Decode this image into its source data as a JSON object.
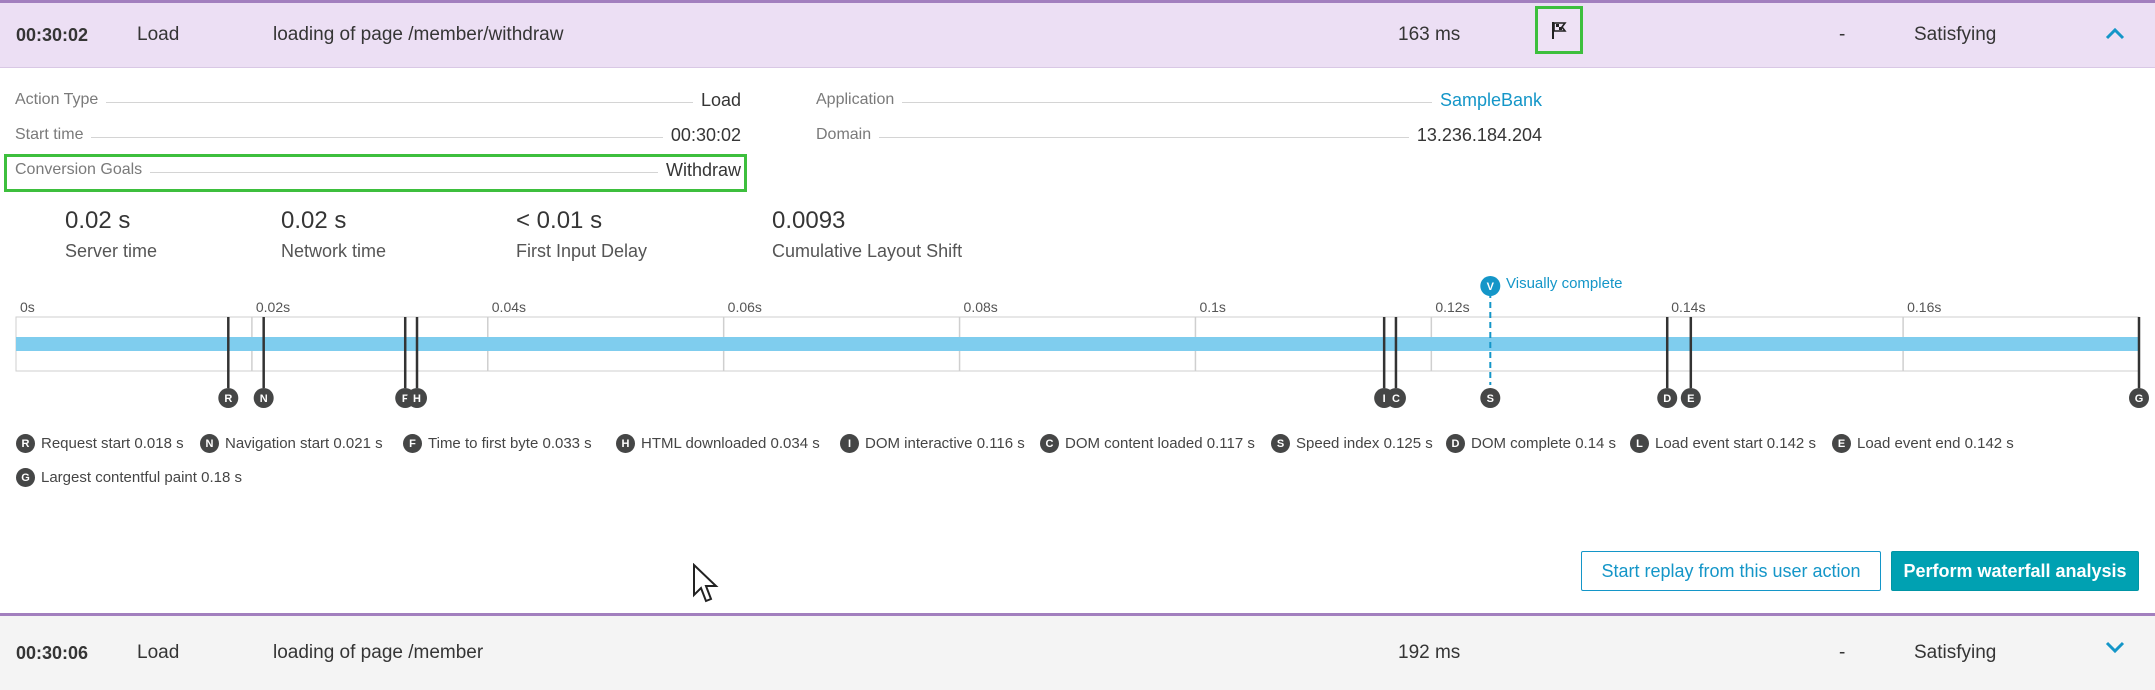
{
  "action_row": {
    "time": "00:30:02",
    "type": "Load",
    "name": "loading of page /member/withdraw",
    "duration": "163 ms",
    "dash": "-",
    "apdex": "Satisfying",
    "flag_icon": "conversion-goal-flag-icon"
  },
  "details": {
    "action_type_label": "Action Type",
    "action_type_value": "Load",
    "start_time_label": "Start time",
    "start_time_value": "00:30:02",
    "conversion_goals_label": "Conversion Goals",
    "conversion_goals_value": "Withdraw",
    "application_label": "Application",
    "application_value": "SampleBank",
    "domain_label": "Domain",
    "domain_value": "13.236.184.204"
  },
  "metrics": [
    {
      "value": "0.02 s",
      "label": "Server time"
    },
    {
      "value": "0.02 s",
      "label": "Network time"
    },
    {
      "value": "< 0.01 s",
      "label": "First Input Delay"
    },
    {
      "value": "0.0093",
      "label": "Cumulative Layout Shift"
    }
  ],
  "timeline": {
    "axis_labels": [
      "0s",
      "0.02s",
      "0.04s",
      "0.06s",
      "0.08s",
      "0.1s",
      "0.12s",
      "0.14s",
      "0.16s"
    ],
    "axis_values": [
      0,
      0.02,
      0.04,
      0.06,
      0.08,
      0.1,
      0.12,
      0.14,
      0.16
    ],
    "max": 0.18,
    "bar_color": "#7fcdee",
    "visually_complete_label": "Visually complete",
    "visually_complete_badge": "V",
    "visually_complete_time": 0.125,
    "markers": [
      {
        "letter": "R",
        "time": 0.018
      },
      {
        "letter": "N",
        "time": 0.021
      },
      {
        "letter": "F",
        "time": 0.033
      },
      {
        "letter": "H",
        "time": 0.034
      },
      {
        "letter": "I",
        "time": 0.116
      },
      {
        "letter": "C",
        "time": 0.117
      },
      {
        "letter": "S",
        "time": 0.125
      },
      {
        "letter": "D",
        "time": 0.14
      },
      {
        "letter": "E",
        "time": 0.142
      },
      {
        "letter": "G",
        "time": 0.18
      }
    ]
  },
  "legend": [
    {
      "letter": "R",
      "text": "Request start 0.018 s"
    },
    {
      "letter": "N",
      "text": "Navigation start 0.021 s"
    },
    {
      "letter": "F",
      "text": "Time to first byte 0.033 s"
    },
    {
      "letter": "H",
      "text": "HTML downloaded 0.034 s"
    },
    {
      "letter": "I",
      "text": "DOM interactive 0.116 s"
    },
    {
      "letter": "C",
      "text": "DOM content loaded 0.117 s"
    },
    {
      "letter": "S",
      "text": "Speed index 0.125 s"
    },
    {
      "letter": "D",
      "text": "DOM complete 0.14 s"
    },
    {
      "letter": "L",
      "text": "Load event start 0.142 s"
    },
    {
      "letter": "E",
      "text": "Load event end 0.142 s"
    },
    {
      "letter": "G",
      "text": "Largest contentful paint 0.18 s"
    }
  ],
  "buttons": {
    "replay": "Start replay from this user action",
    "waterfall": "Perform waterfall analysis"
  },
  "next_row": {
    "time": "00:30:06",
    "type": "Load",
    "name": "loading of page /member",
    "duration": "192 ms",
    "dash": "-",
    "apdex": "Satisfying"
  },
  "colors": {
    "accent": "#1496c8",
    "primary_button": "#00a1b2",
    "row_highlight": "#ecdff4",
    "highlight_box": "#3dbf3d"
  }
}
